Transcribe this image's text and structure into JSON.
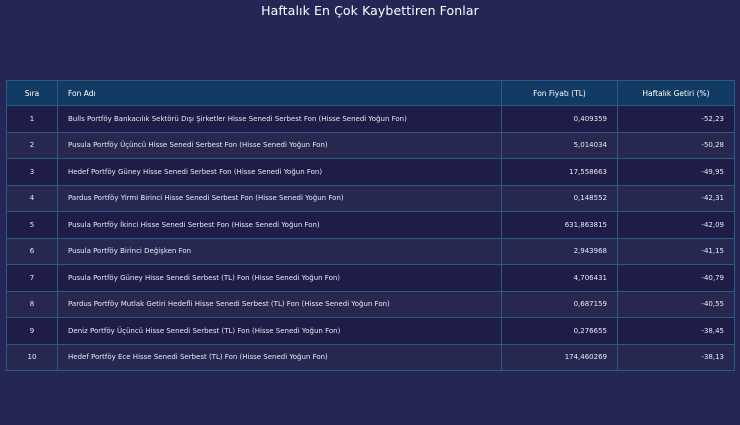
{
  "title": "Haftalık En Çok Kaybettiren Fonlar",
  "chart_data": {
    "type": "table",
    "title": "Haftalık En Çok Kaybettiren Fonlar",
    "columns": [
      "Sıra",
      "Fon Adı",
      "Fon Fiyatı (TL)",
      "Haftalık Getiri (%)"
    ],
    "rows": [
      [
        "1",
        "Bulls Portföy Bankacılık Sektörü Dışı Şirketler Hisse Senedi Serbest Fon (Hisse Senedi Yoğun Fon)",
        "0,409359",
        "-52,23"
      ],
      [
        "2",
        "Pusula Portföy Üçüncü Hisse Senedi Serbest Fon (Hisse Senedi Yoğun Fon)",
        "5,014034",
        "-50,28"
      ],
      [
        "3",
        "Hedef Portföy Güney Hisse Senedi Serbest Fon (Hisse Senedi Yoğun Fon)",
        "17,558663",
        "-49,95"
      ],
      [
        "4",
        "Pardus Portföy Yirmi Birinci Hisse Senedi Serbest Fon (Hisse Senedi Yoğun Fon)",
        "0,148552",
        "-42,31"
      ],
      [
        "5",
        "Pusula Portföy İkinci Hisse Senedi Serbest Fon (Hisse Senedi Yoğun Fon)",
        "631,863815",
        "-42,09"
      ],
      [
        "6",
        "Pusula Portföy Birinci Değişken Fon",
        "2,943968",
        "-41,15"
      ],
      [
        "7",
        "Pusula Portföy Güney Hisse Senedi Serbest (TL) Fon (Hisse Senedi Yoğun Fon)",
        "4,706431",
        "-40,79"
      ],
      [
        "8",
        "Pardus Portföy Mutlak Getiri Hedefli Hisse Senedi Serbest (TL) Fon (Hisse Senedi Yoğun Fon)",
        "0,687159",
        "-40,55"
      ],
      [
        "9",
        "Deniz Portföy Üçüncü Hisse Senedi Serbest (TL) Fon (Hisse Senedi Yoğun Fon)",
        "0,276655",
        "-38,45"
      ],
      [
        "10",
        "Hedef Portföy Ece Hisse Senedi Serbest (TL) Fon (Hisse Senedi Yoğun Fon)",
        "174,460269",
        "-38,13"
      ]
    ]
  },
  "colors": {
    "background": "#242656",
    "header": "#123b63",
    "row_odd": "#1d1d47",
    "row_even": "#262850",
    "border": "#2c5a80"
  }
}
